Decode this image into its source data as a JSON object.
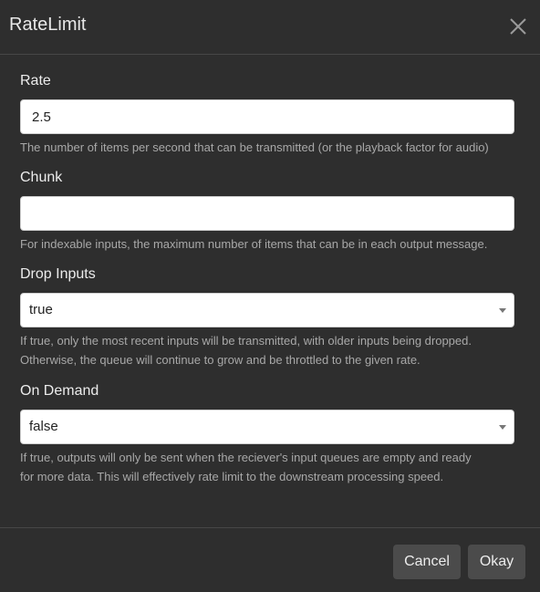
{
  "dialog": {
    "title": "RateLimit",
    "close_icon": "close-icon"
  },
  "fields": {
    "rate": {
      "label": "Rate",
      "value": "2.5",
      "help": "The number of items per second that can be transmitted (or the playback factor for audio)"
    },
    "chunk": {
      "label": "Chunk",
      "value": "",
      "help": "For indexable inputs, the maximum number of items that can be in each output message."
    },
    "drop_inputs": {
      "label": "Drop Inputs",
      "value": "true",
      "help_line1": "If true, only the most recent inputs will be transmitted, with older inputs being dropped.",
      "help_line2": "Otherwise, the queue will continue to grow and be throttled to the given rate."
    },
    "on_demand": {
      "label": "On Demand",
      "value": "false",
      "help_line1": "If true, outputs will only be sent when the reciever's input queues are empty and ready",
      "help_line2": "for more data. This will effectively rate limit to the downstream processing speed."
    }
  },
  "footer": {
    "cancel_label": "Cancel",
    "okay_label": "Okay"
  }
}
